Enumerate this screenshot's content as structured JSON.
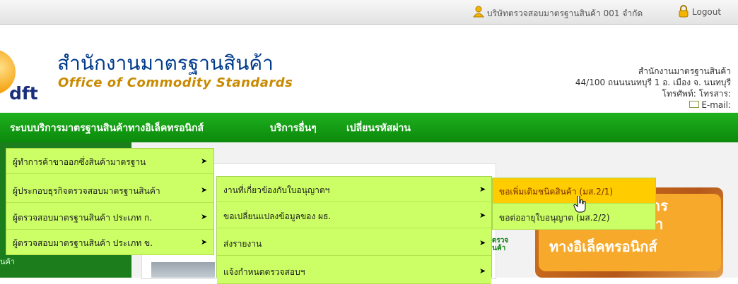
{
  "userbar": {
    "company": "บริษัทตรวจสอบมาตรฐานสินค้า 001 จำกัด",
    "logout": "Logout"
  },
  "header": {
    "logo_text": "dft",
    "title_th": "สำนักงานมาตรฐานสินค้า",
    "title_en": "Office of Commodity Standards",
    "contact": {
      "org": "สำนักงานมาตรฐานสินค้า",
      "address": "44/100 ถนนนนทบุรี 1 อ. เมือง จ. นนทบุรี",
      "phone": "โทรศัพท์: โทรสาร:",
      "email": "E-mail:"
    }
  },
  "nav": {
    "items": [
      {
        "label": "ระบบบริการมาตรฐานสินค้าทางอิเล็คทรอนิกส์"
      },
      {
        "label": "บริการอื่นๆ"
      },
      {
        "label": "เปลี่ยนรหัสผ่าน"
      }
    ]
  },
  "menu_level1": [
    {
      "label": "ผู้ทำการค้าขาออกซึ่งสินค้ามาตรฐาน",
      "arrow": "➤"
    },
    {
      "label": "ผู้ประกอบธุรกิจตรวจสอบมาตรฐานสินค้า",
      "arrow": "➤"
    },
    {
      "label": "ผู้ตรวจสอบมาตรฐานสินค้า ประเภท ก.",
      "arrow": "➤"
    },
    {
      "label": "ผู้ตรวจสอบมาตรฐานสินค้า ประเภท ข.",
      "arrow": "➤"
    }
  ],
  "menu_level2": [
    {
      "label": "งานที่เกี่ยวข้องกับใบอนุญาตฯ",
      "arrow": "➤"
    },
    {
      "label": "ขอเปลี่ยนแปลงข้อมูลของ ผธ.",
      "arrow": "➤"
    },
    {
      "label": "ส่งรายงาน",
      "arrow": "➤"
    },
    {
      "label": "แจ้งกำหนดตรวจสอบฯ",
      "arrow": "➤"
    }
  ],
  "menu_level3": [
    {
      "label": "ขอเพิ่มเติมชนิดสินค้า (มส.2/1)"
    },
    {
      "label": "ขอต่ออายุใบอนุญาต (มส.2/2)"
    }
  ],
  "banner": {
    "line1": "ริการ",
    "line2": "นค้า",
    "line3": "ทางอิเล็คทรอนิกส์"
  },
  "side_text": {
    "line1": "ผู้ตรวจ",
    "line2": "สินค้า"
  },
  "left_panel_text": "นค้า",
  "colors": {
    "nav_green": "#12a012",
    "menu_bg": "#ccff66",
    "menu_active": "#ffcc00",
    "title_blue": "#003a8c",
    "title_gold": "#c98a00"
  }
}
